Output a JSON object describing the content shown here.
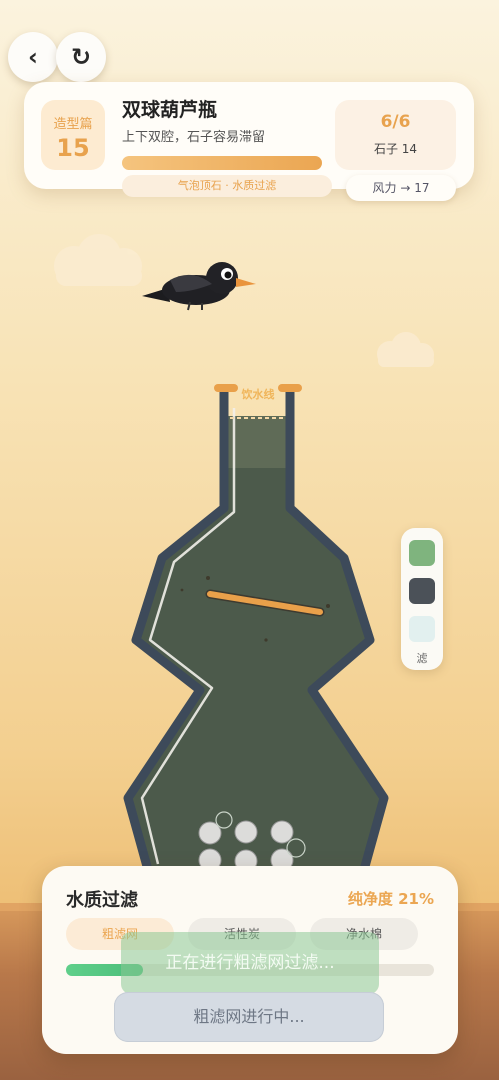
{
  "nav": {
    "back_icon": "back-icon",
    "reset_icon": "reset-icon",
    "back_glyph": "‹",
    "reset_glyph": "↻"
  },
  "level": {
    "badge_label": "造型篇",
    "number": "15",
    "title": "双球葫芦瓶",
    "subtitle": "上下双腔，石子容易滞留",
    "tag": "气泡顶石 · 水质过滤",
    "stones_progress": "6/6",
    "stones_label": "石子 14",
    "wind": "风力 → 17"
  },
  "bottle": {
    "water_line_label": "饮水线"
  },
  "filter_side": {
    "swatches": [
      "#7fb47e",
      "#4b5158",
      "#e2f0ef"
    ],
    "label": "滤"
  },
  "water_panel": {
    "title": "水质过滤",
    "purity": "纯净度 21%",
    "purity_value": 21,
    "stages": [
      "粗滤网",
      "活性炭",
      "净水棉"
    ],
    "active_stage": 0,
    "progress": 0.21,
    "banner": "正在进行粗滤网过滤...",
    "action_button": "粗滤网进行中..."
  },
  "colors": {
    "accent": "#eba652",
    "water": "#4e5c4c",
    "bottle_outline": "#3d4a5a",
    "progress": "#4bbd79"
  }
}
